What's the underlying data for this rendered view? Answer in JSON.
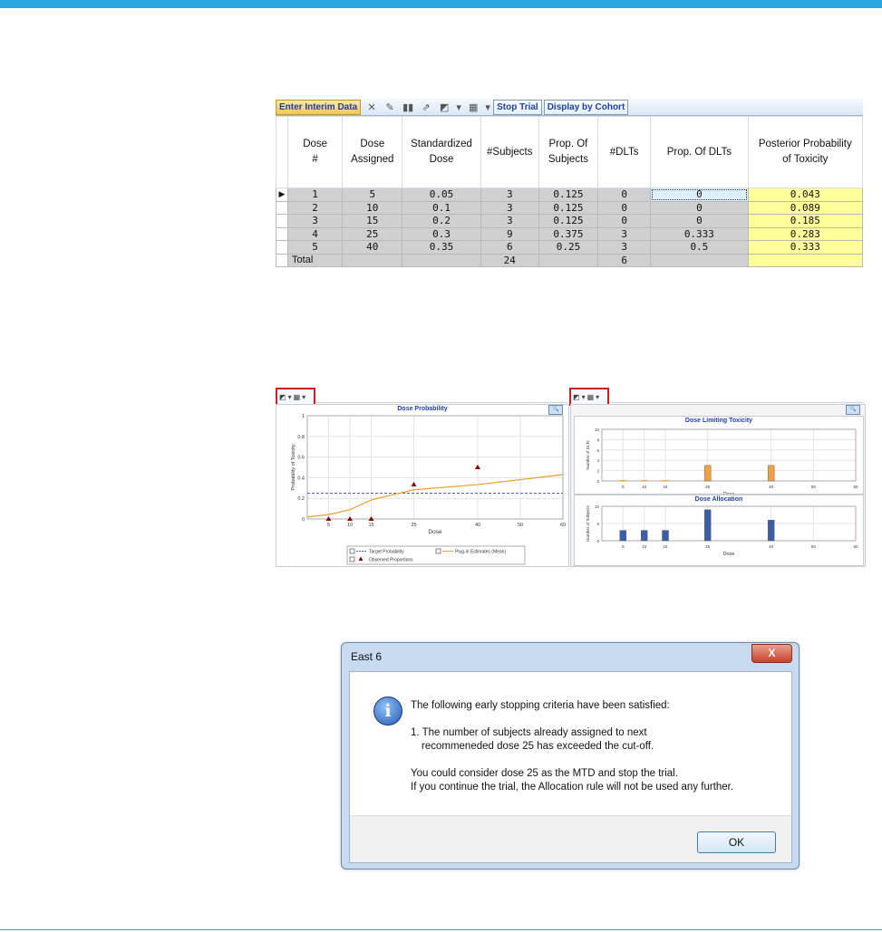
{
  "toolbar": {
    "enter_interim": "Enter Interim Data",
    "stop_trial": "Stop Trial",
    "display_cohort": "Display by Cohort"
  },
  "table": {
    "headers": [
      "Dose\n#",
      "Dose\nAssigned",
      "Standardized\nDose",
      "#Subjects",
      "Prop. Of\nSubjects",
      "#DLTs",
      "Prop. Of DLTs",
      "Posterior Probability\nof Toxicity"
    ],
    "rows": [
      [
        "1",
        "5",
        "0.05",
        "3",
        "0.125",
        "0",
        "0",
        "0.043"
      ],
      [
        "2",
        "10",
        "0.1",
        "3",
        "0.125",
        "0",
        "0",
        "0.089"
      ],
      [
        "3",
        "15",
        "0.2",
        "3",
        "0.125",
        "0",
        "0",
        "0.185"
      ],
      [
        "4",
        "25",
        "0.3",
        "9",
        "0.375",
        "3",
        "0.333",
        "0.283"
      ],
      [
        "5",
        "40",
        "0.35",
        "6",
        "0.25",
        "3",
        "0.5",
        "0.333"
      ]
    ],
    "total_label": "Total",
    "total_subjects": "24",
    "total_dlts": "6",
    "row_pointer": "▶"
  },
  "chart_data": [
    {
      "type": "line",
      "title": "Dose Probability",
      "xlabel": "Dose",
      "ylabel": "Probability of Toxicity",
      "xlim": [
        0,
        60
      ],
      "ylim": [
        0,
        1
      ],
      "xticks": [
        5,
        10,
        15,
        25,
        40,
        50,
        60
      ],
      "yticks": [
        0,
        0.2,
        0.4,
        0.6,
        0.8,
        1
      ],
      "target_probability": 0.25,
      "series": [
        {
          "name": "Target Probability",
          "style": "dashed",
          "color": "#4a5fb5",
          "x": [
            0,
            60
          ],
          "values": [
            0.25,
            0.25
          ]
        },
        {
          "name": "Plug-in Estimates (Mean)",
          "style": "line",
          "color": "#e8a030",
          "x": [
            0,
            5,
            10,
            15,
            25,
            40,
            60
          ],
          "values": [
            0.02,
            0.043,
            0.089,
            0.185,
            0.283,
            0.333,
            0.43
          ]
        },
        {
          "name": "Observed Proportions",
          "style": "marker",
          "color": "#8b0000",
          "x": [
            5,
            10,
            15,
            25,
            40
          ],
          "values": [
            0,
            0,
            0,
            0.333,
            0.5
          ]
        }
      ],
      "legend": "bottom",
      "grid": true
    },
    {
      "type": "bar",
      "title": "Dose Limiting Toxicity",
      "xlabel": "Dose",
      "ylabel": "Number of DLTs",
      "xlim": [
        0,
        60
      ],
      "ylim": [
        0,
        10
      ],
      "xticks": [
        5,
        10,
        15,
        25,
        40,
        50,
        60
      ],
      "yticks": [
        0,
        2,
        4,
        6,
        8,
        10
      ],
      "x": [
        5,
        10,
        15,
        25,
        40
      ],
      "values": [
        0,
        0,
        0,
        3,
        3
      ],
      "color": "#f0a040",
      "grid": true
    },
    {
      "type": "bar",
      "title": "Dose Allocation",
      "xlabel": "Dose",
      "ylabel": "Number of Subjects",
      "xlim": [
        0,
        60
      ],
      "ylim": [
        0,
        10
      ],
      "xticks": [
        5,
        10,
        15,
        25,
        40,
        50,
        60
      ],
      "yticks": [
        0,
        5,
        10
      ],
      "x": [
        5,
        10,
        15,
        25,
        40
      ],
      "values": [
        3,
        3,
        3,
        9,
        6
      ],
      "color": "#3a5ea8",
      "grid": true
    }
  ],
  "dialog": {
    "title": "East 6",
    "close": "X",
    "line1": "The following early stopping criteria  have been satisfied:",
    "line2": "1. The number of subjects already assigned to next",
    "line3": "recommeneded dose 25 has exceeded the cut-off.",
    "line4": "You could consider dose 25 as the MTD and stop the trial.",
    "line5": "If you continue the trial, the Allocation rule will not be used any further.",
    "ok": "OK"
  },
  "colors": {
    "accent": "#29a8e0",
    "highlight": "#ffff99",
    "grid_cell": "#d0d0d0"
  }
}
